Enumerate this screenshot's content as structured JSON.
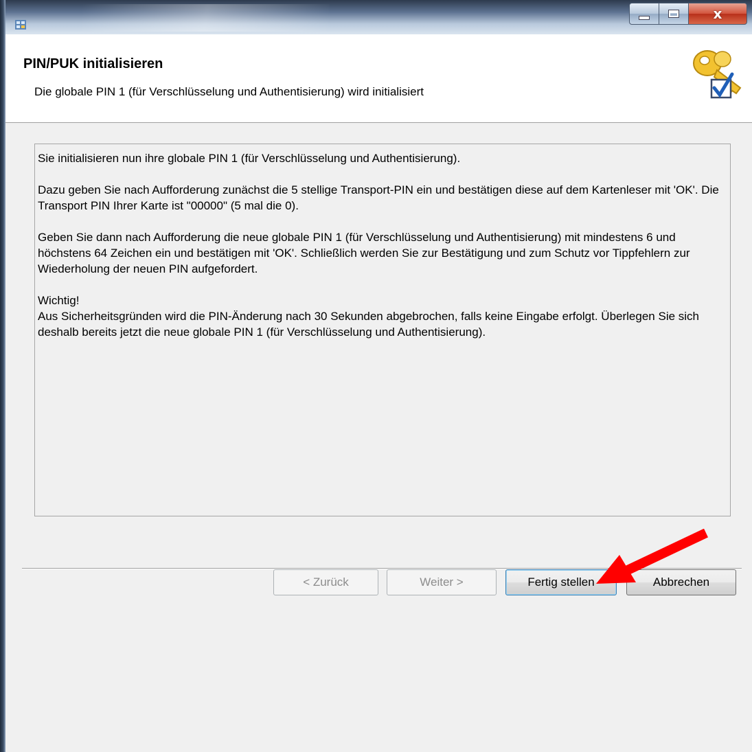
{
  "window": {
    "controls": {
      "minimize_icon": "minimize-icon",
      "maximize_icon": "maximize-icon",
      "close_label": "x"
    }
  },
  "header": {
    "title": "PIN/PUK initialisieren",
    "subtitle": "Die globale PIN 1 (für Verschlüsselung und Authentisierung) wird initialisiert",
    "icon": "key-checkmark-icon"
  },
  "info": {
    "p1": "Sie initialisieren nun ihre globale PIN 1 (für Verschlüsselung und Authentisierung).",
    "p2": "Dazu geben Sie nach Aufforderung zunächst die 5 stellige Transport-PIN ein und bestätigen diese auf dem Kartenleser mit 'OK'. Die Transport PIN Ihrer Karte ist \"00000\" (5 mal die 0).",
    "p3": "Geben Sie dann nach Aufforderung die neue globale PIN 1 (für Verschlüsselung und Authentisierung) mit mindestens 6 und höchstens 64 Zeichen ein und bestätigen mit 'OK'. Schließlich werden Sie zur Bestätigung und zum Schutz vor Tippfehlern zur Wiederholung der neuen PIN aufgefordert.",
    "p4_heading": "Wichtig!",
    "p4": "Aus Sicherheitsgründen wird die PIN-Änderung nach 30 Sekunden abgebrochen, falls keine Eingabe erfolgt. Überlegen Sie sich deshalb bereits jetzt die neue globale PIN 1 (für Verschlüsselung und Authentisierung)."
  },
  "buttons": {
    "back": "< Zurück",
    "next": "Weiter >",
    "finish": "Fertig stellen",
    "cancel": "Abbrechen"
  },
  "annotation": {
    "arrow_color": "#ff0000"
  }
}
